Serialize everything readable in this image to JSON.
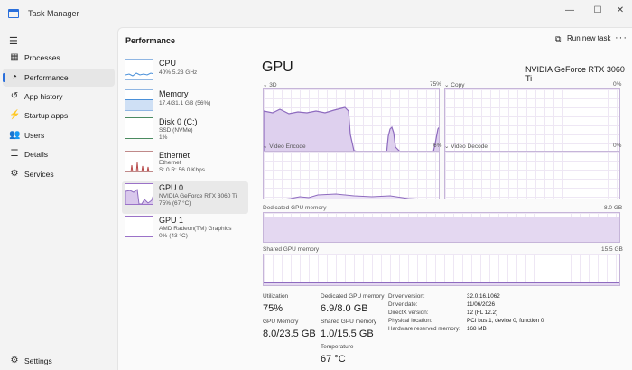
{
  "window": {
    "title": "Task Manager",
    "minimize": "—",
    "maximize": "☐",
    "close": "✕"
  },
  "sidebar": {
    "items": [
      {
        "label": "Processes",
        "icon": "processes-icon"
      },
      {
        "label": "Performance",
        "icon": "performance-icon",
        "active": true
      },
      {
        "label": "App history",
        "icon": "app-history-icon"
      },
      {
        "label": "Startup apps",
        "icon": "startup-apps-icon"
      },
      {
        "label": "Users",
        "icon": "users-icon"
      },
      {
        "label": "Details",
        "icon": "details-icon"
      },
      {
        "label": "Services",
        "icon": "services-icon"
      }
    ],
    "settings_label": "Settings"
  },
  "header": {
    "title": "Performance",
    "run_new_task": "Run new task",
    "more": "···"
  },
  "devices": [
    {
      "name": "CPU",
      "sub1": "40% 5.23 GHz",
      "sub2": ""
    },
    {
      "name": "Memory",
      "sub1": "17.4/31.1 GB (56%)",
      "sub2": ""
    },
    {
      "name": "Disk 0 (C:)",
      "sub1": "SSD (NVMe)",
      "sub2": "1%"
    },
    {
      "name": "Ethernet",
      "sub1": "Ethernet",
      "sub2": "S: 0 R: 56.0 Kbps"
    },
    {
      "name": "GPU 0",
      "sub1": "NVIDIA GeForce RTX 3060 Ti",
      "sub2": "75% (67 °C)"
    },
    {
      "name": "GPU 1",
      "sub1": "AMD Radeon(TM) Graphics",
      "sub2": "0% (43 °C)"
    }
  ],
  "gpu": {
    "title": "GPU",
    "model": "NVIDIA GeForce RTX 3060 Ti",
    "engines": [
      {
        "name": "3D",
        "max": "75%"
      },
      {
        "name": "Copy",
        "max": "0%"
      },
      {
        "name": "Video Encode",
        "max": "6%"
      },
      {
        "name": "Video Decode",
        "max": "0%"
      }
    ],
    "dedicated": {
      "label": "Dedicated GPU memory",
      "max": "8.0 GB",
      "level": 0.86
    },
    "shared": {
      "label": "Shared GPU memory",
      "max": "15.5 GB",
      "level": 0.08
    },
    "stats": {
      "utilization": {
        "label": "Utilization",
        "value": "75%"
      },
      "dedicated_mem": {
        "label": "Dedicated GPU memory",
        "value": "6.9/8.0 GB"
      },
      "gpu_memory": {
        "label": "GPU Memory",
        "value": "8.0/23.5 GB"
      },
      "shared_mem": {
        "label": "Shared GPU memory",
        "value": "1.0/15.5 GB"
      },
      "temperature": {
        "label": "Temperature",
        "value": "67 °C"
      }
    },
    "info": [
      {
        "key": "Driver version:",
        "value": "32.0.16.1062"
      },
      {
        "key": "Driver date:",
        "value": "11/06/2026"
      },
      {
        "key": "DirectX version:",
        "value": "12 (FL 12.2)"
      },
      {
        "key": "Physical location:",
        "value": "PCI bus 1, device 0, function 0"
      },
      {
        "key": "Hardware reserved memory:",
        "value": "168 MB"
      }
    ]
  },
  "colors": {
    "accent": "#2a6fdb",
    "gpu_graph": "#8e6bbf",
    "gpu_fill": "#d9c8ec",
    "cpu_graph": "#4a90d9",
    "ethernet_graph": "#b84b4b"
  }
}
